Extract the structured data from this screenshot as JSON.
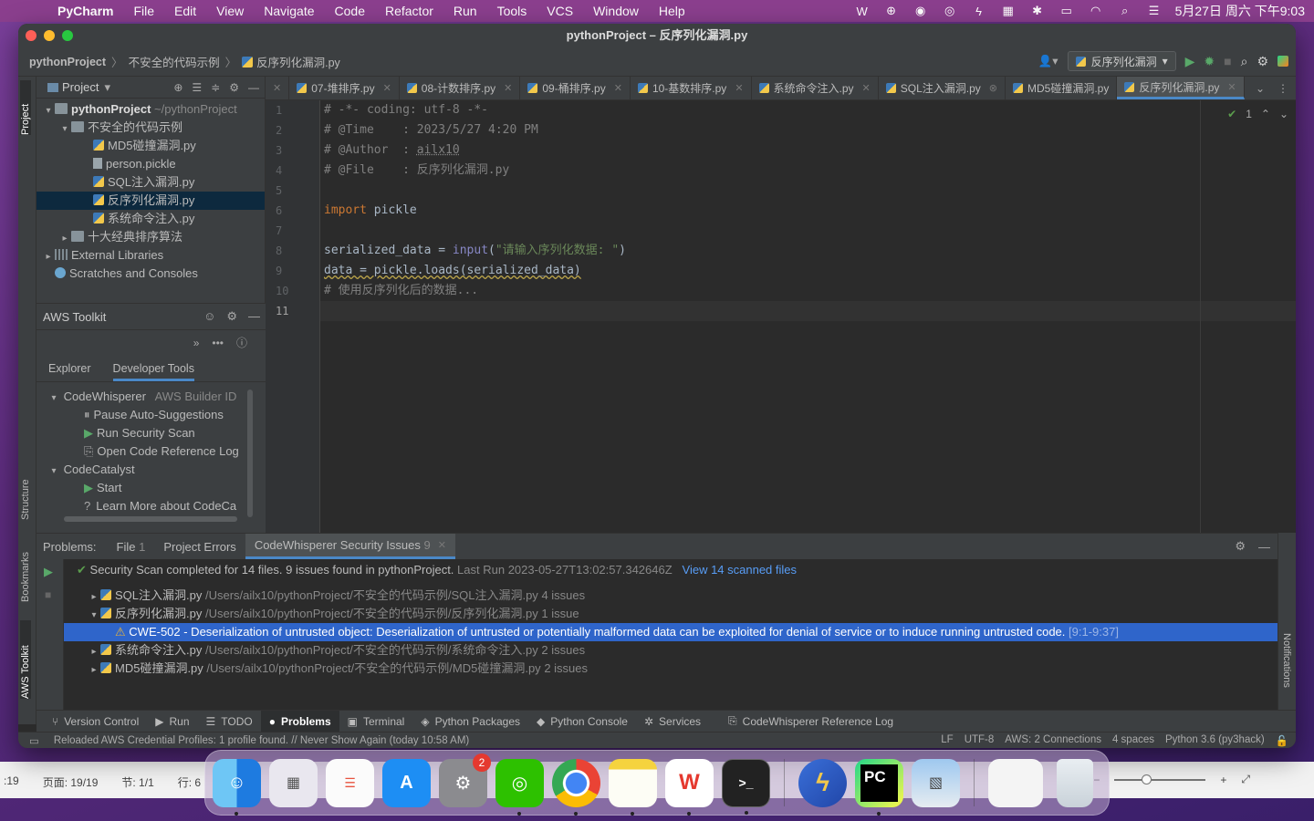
{
  "menubar": {
    "app": "PyCharm",
    "items": [
      "File",
      "Edit",
      "View",
      "Navigate",
      "Code",
      "Refactor",
      "Run",
      "Tools",
      "VCS",
      "Window",
      "Help"
    ],
    "clock": "5月27日 周六 下午9:03"
  },
  "window": {
    "title": "pythonProject – 反序列化漏洞.py"
  },
  "breadcrumb": {
    "items": [
      "pythonProject",
      "不安全的代码示例",
      "反序列化漏洞.py"
    ]
  },
  "run_config": {
    "label": "反序列化漏洞"
  },
  "left_stripe": {
    "project": "Project",
    "structure": "Structure",
    "bookmarks": "Bookmarks",
    "aws": "AWS Toolkit"
  },
  "project_panel": {
    "title": "Project",
    "tree": [
      {
        "label": "pythonProject",
        "hint": "~/pythonProject"
      },
      {
        "label": "不安全的代码示例"
      },
      {
        "label": "MD5碰撞漏洞.py"
      },
      {
        "label": "person.pickle"
      },
      {
        "label": "SQL注入漏洞.py"
      },
      {
        "label": "反序列化漏洞.py"
      },
      {
        "label": "系统命令注入.py"
      },
      {
        "label": "十大经典排序算法"
      },
      {
        "label": "External Libraries"
      },
      {
        "label": "Scratches and Consoles"
      }
    ]
  },
  "aws_toolkit": {
    "title": "AWS Toolkit",
    "tabs": [
      "Explorer",
      "Developer Tools"
    ],
    "items": [
      {
        "label": "CodeWhisperer",
        "hint": "AWS Builder ID"
      },
      {
        "label": "Pause Auto-Suggestions"
      },
      {
        "label": "Run Security Scan"
      },
      {
        "label": "Open Code Reference Log"
      },
      {
        "label": "CodeCatalyst"
      },
      {
        "label": "Start"
      },
      {
        "label": "Learn More about CodeCa"
      }
    ]
  },
  "tabs": [
    {
      "label": "07-堆排序.py"
    },
    {
      "label": "08-计数排序.py"
    },
    {
      "label": "09-桶排序.py"
    },
    {
      "label": "10-基数排序.py"
    },
    {
      "label": "系统命令注入.py"
    },
    {
      "label": "SQL注入漏洞.py"
    },
    {
      "label": "MD5碰撞漏洞.py"
    },
    {
      "label": "反序列化漏洞.py"
    }
  ],
  "editor": {
    "line_numbers": [
      "1",
      "2",
      "3",
      "4",
      "5",
      "6",
      "7",
      "8",
      "9",
      "10",
      "11"
    ],
    "lines": {
      "l1": "# -*- coding: utf-8 -*-",
      "l2": "# @Time    : 2023/5/27 4:20 PM",
      "l3a": "# @Author  : ",
      "l3b": "ailx10",
      "l4": "# @File    : 反序列化漏洞.py",
      "l6a": "import",
      "l6b": " pickle",
      "l8a": "serialized_data = ",
      "l8b": "input",
      "l8c": "(",
      "l8d": "\"请输入序列化数据: \"",
      "l8e": ")",
      "l9": "data = pickle.loads(serialized_data)",
      "l10": "# 使用反序列化后的数据..."
    },
    "inspection_count": "1"
  },
  "problems": {
    "label": "Problems:",
    "tabs": [
      {
        "label": "File",
        "count": "1"
      },
      {
        "label": "Project Errors"
      },
      {
        "label": "CodeWhisperer Security Issues",
        "count": "9"
      }
    ],
    "summary": "Security Scan completed for 14 files. 9 issues found in pythonProject.",
    "last_run": "Last Run 2023-05-27T13:02:57.342646Z",
    "view_link": "View 14 scanned files",
    "files": [
      {
        "name": "SQL注入漏洞.py",
        "path": "/Users/ailx10/pythonProject/不安全的代码示例/SQL注入漏洞.py",
        "count": "4 issues"
      },
      {
        "name": "反序列化漏洞.py",
        "path": "/Users/ailx10/pythonProject/不安全的代码示例/反序列化漏洞.py",
        "count": "1 issue"
      },
      {
        "name": "系统命令注入.py",
        "path": "/Users/ailx10/pythonProject/不安全的代码示例/系统命令注入.py",
        "count": "2 issues"
      },
      {
        "name": "MD5碰撞漏洞.py",
        "path": "/Users/ailx10/pythonProject/不安全的代码示例/MD5碰撞漏洞.py",
        "count": "2 issues"
      }
    ],
    "issue": {
      "text": "CWE-502 - Deserialization of untrusted object: Deserialization of untrusted or potentially malformed data can be exploited for denial of service or to induce running untrusted code.",
      "range": "[9:1-9:37]"
    }
  },
  "bottom_tools": [
    "Version Control",
    "Run",
    "TODO",
    "Problems",
    "Terminal",
    "Python Packages",
    "Python Console",
    "Services",
    "CodeWhisperer Reference Log"
  ],
  "status_bar": {
    "message": "Reloaded AWS Credential Profiles: 1 profile found. // Never Show Again (today 10:58 AM)",
    "line_sep": "LF",
    "encoding": "UTF-8",
    "aws": "AWS: 2 Connections",
    "indent": "4 spaces",
    "interpreter": "Python 3.6 (py3hack)"
  },
  "notifications": "Notifications",
  "back_window": {
    "left": [
      ":19",
      "页面: 19/19",
      "节: 1/1",
      "行: 6"
    ]
  },
  "dock": {
    "settings_badge": "2"
  }
}
